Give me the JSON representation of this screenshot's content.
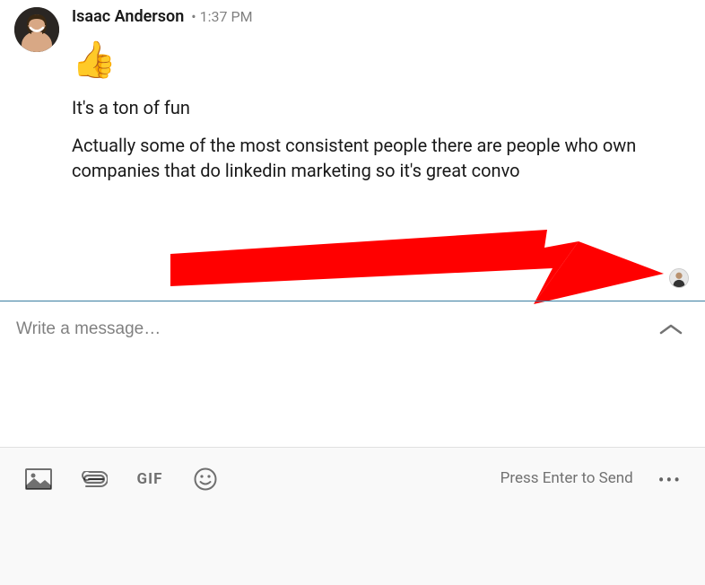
{
  "message": {
    "sender_name": "Isaac Anderson",
    "timestamp": "1:37 PM",
    "emoji": "👍",
    "line1": "It's a ton of fun",
    "line2": "Actually some of the most consistent people there are people who own companies that do linkedin marketing so it's great convo"
  },
  "compose": {
    "placeholder": "Write a message…"
  },
  "toolbar": {
    "gif_label": "GIF",
    "send_hint": "Press Enter to Send",
    "more_dots": "•••"
  },
  "annotation": {
    "arrow_color": "#ff0000"
  }
}
